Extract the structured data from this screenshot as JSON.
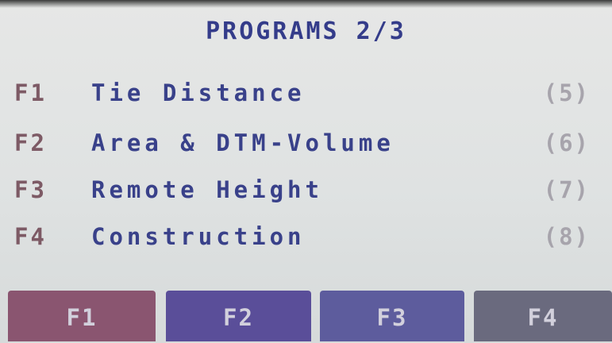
{
  "screen": {
    "title": "PROGRAMS 2/3"
  },
  "programs": [
    {
      "key": "F1",
      "label": "Tie Distance",
      "number": "(5)"
    },
    {
      "key": "F2",
      "label": "Area & DTM-Volume",
      "number": "(6)"
    },
    {
      "key": "F3",
      "label": "Remote Height",
      "number": "(7)"
    },
    {
      "key": "F4",
      "label": "Construction",
      "number": "(8)"
    }
  ],
  "softkeys": [
    {
      "label": "F1",
      "color": "#8a5570"
    },
    {
      "label": "F2",
      "color": "#5a4e99"
    },
    {
      "label": "F3",
      "color": "#5d5c9d"
    },
    {
      "label": "F4",
      "color": "#6a6a7e"
    }
  ],
  "colors": {
    "text_primary": "#39418a",
    "fkey_text": "#7d5a65",
    "number_text": "#a7a4ac",
    "screen_background": "#e2e4e3"
  }
}
